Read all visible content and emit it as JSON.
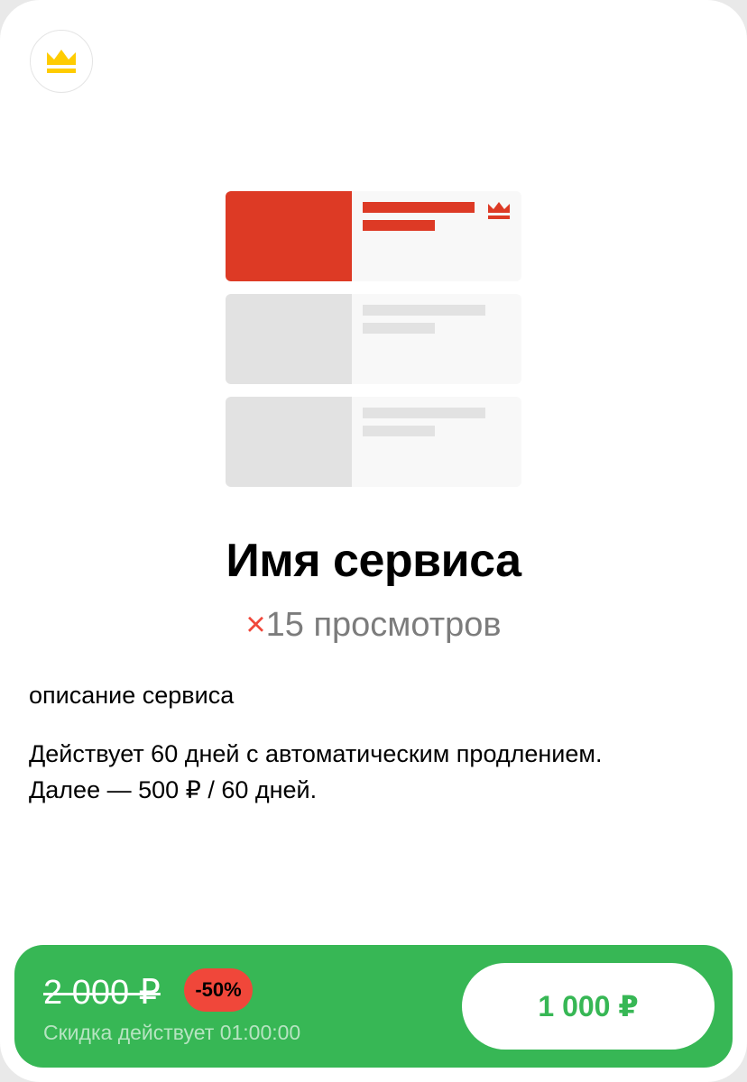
{
  "service": {
    "title": "Имя сервиса",
    "multiplier_sign": "×",
    "views_text": "15 просмотров",
    "description": "описание сервиса",
    "terms_line1": "Действует 60 дней с автоматическим продлением.",
    "terms_line2": "Далее — 500 ₽ / 60 дней."
  },
  "purchase": {
    "old_price": "2 000 ₽",
    "discount": "-50%",
    "timer_text": "Скидка действует 01:00:00",
    "price_button_label": "1 000 ₽"
  },
  "icons": {
    "badge": "crown-icon",
    "illustration": "promoted-listing-illustration"
  },
  "colors": {
    "accent_red": "#dd3a25",
    "crown_yellow": "#ffcc00",
    "buy_green": "#37b755",
    "discount_red": "#f0473a"
  }
}
